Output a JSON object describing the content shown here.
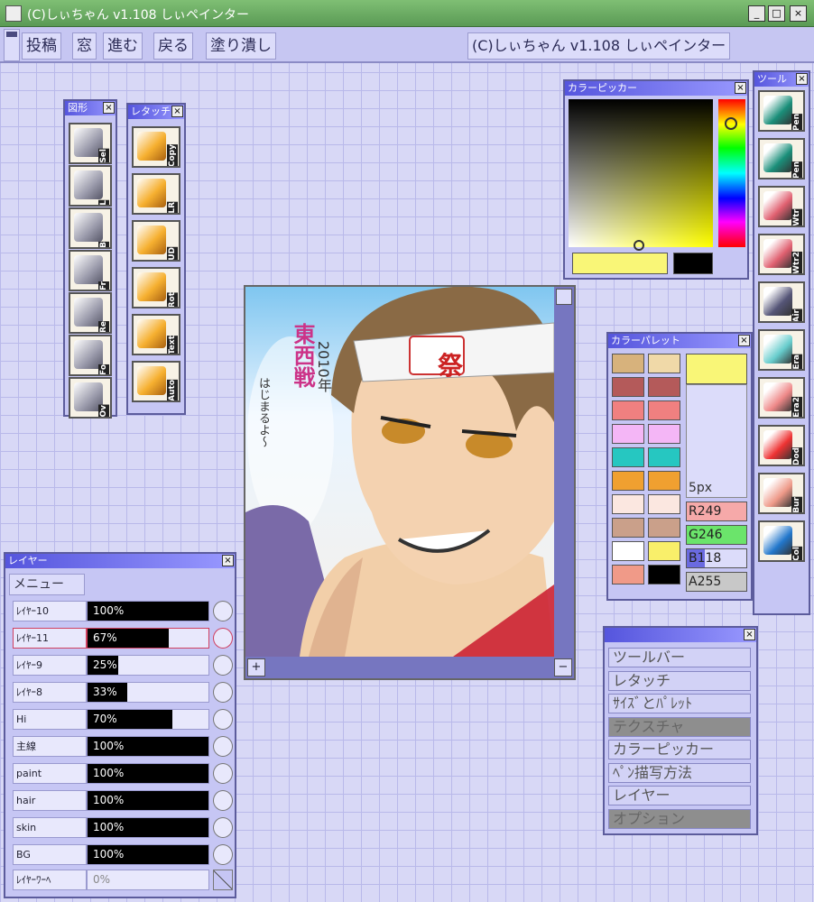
{
  "window": {
    "title": "(C)しぃちゃん v1.108 しぃペインター",
    "min": "_",
    "max": "□",
    "close": "×"
  },
  "menubar": {
    "items": [
      "投稿",
      "窓",
      "進む",
      "戻る",
      "塗り潰し"
    ],
    "about": "(C)しぃちゃん v1.108 しぃペインター"
  },
  "figure_panel": {
    "title": "図形",
    "close": "×",
    "tools": [
      {
        "name": "lasso",
        "label": "Sel"
      },
      {
        "name": "line",
        "label": "L"
      },
      {
        "name": "bezier",
        "label": "B"
      },
      {
        "name": "rect-fill",
        "label": "Fr"
      },
      {
        "name": "rect",
        "label": "Re"
      },
      {
        "name": "oval-fill",
        "label": "Fo"
      },
      {
        "name": "oval",
        "label": "Ov"
      }
    ]
  },
  "retouch_panel": {
    "title": "レタッチ",
    "close": "×",
    "tools": [
      {
        "name": "copy",
        "label": "Copy"
      },
      {
        "name": "flip-h",
        "label": "LR"
      },
      {
        "name": "flip-v",
        "label": "UD"
      },
      {
        "name": "rotate",
        "label": "Rot"
      },
      {
        "name": "text",
        "label": "Text"
      },
      {
        "name": "auto",
        "label": "Auto"
      }
    ]
  },
  "color_picker": {
    "title": "カラーピッカー",
    "close": "×",
    "current_color": "#f9f677",
    "sub_color": "#000000"
  },
  "tool_panel": {
    "title": "ツール",
    "close": "×",
    "tools": [
      {
        "name": "pen",
        "label": "Pen",
        "color": "#1a8f7a"
      },
      {
        "name": "pen2",
        "label": "Pen",
        "color": "#1a8f7a"
      },
      {
        "name": "watercolor",
        "label": "Wtr",
        "color": "#e06070"
      },
      {
        "name": "watercolor2",
        "label": "Wtr2",
        "color": "#e06070"
      },
      {
        "name": "airbrush",
        "label": "Air",
        "color": "#555577"
      },
      {
        "name": "eraser",
        "label": "Era",
        "color": "#6cc"
      },
      {
        "name": "eraser2",
        "label": "Era2",
        "color": "#e88"
      },
      {
        "name": "dodge",
        "label": "Dod",
        "color": "#e33"
      },
      {
        "name": "burn",
        "label": "Bur",
        "color": "#e98"
      },
      {
        "name": "drop",
        "label": "Col",
        "color": "#27c"
      }
    ]
  },
  "palette": {
    "title": "カラーパレット",
    "close": "×",
    "size_label": "5px",
    "swatches_left": [
      "#d7b27c",
      "#b45a5a",
      "#f08080",
      "#f4b6f6",
      "#26c7c1",
      "#f0a030",
      "#fbe7e0",
      "#caa08a",
      "#ffffff",
      "#f09a88"
    ],
    "swatches_right": [
      "#f0d9a8",
      "#b45a5a",
      "#f08080",
      "#f4b6f6",
      "#26c7c1",
      "#f0a030",
      "#fbe7e0",
      "#caa08a",
      "#f9ef6a",
      "#000000"
    ],
    "preview_color": "#f9f677",
    "r": "R249",
    "g": "G246",
    "b": "B118",
    "a": "A255"
  },
  "canvas": {
    "title_text": [
      "東西戦",
      "2010年",
      "はじまるよ〜"
    ],
    "badge": "祭"
  },
  "layer_panel": {
    "title": "レイヤー",
    "close": "×",
    "menu_label": "メニュー",
    "layers": [
      {
        "name": "ﾚｲﾔｰ10",
        "opacity": "100%",
        "level": 1.0
      },
      {
        "name": "ﾚｲﾔｰ11",
        "opacity": "67%",
        "level": 0.67
      },
      {
        "name": "ﾚｲﾔｰ9",
        "opacity": "25%",
        "level": 0.25
      },
      {
        "name": "ﾚｲﾔｰ8",
        "opacity": "33%",
        "level": 0.33
      },
      {
        "name": "Hi",
        "opacity": "70%",
        "level": 0.7
      },
      {
        "name": "主線",
        "opacity": "100%",
        "level": 1.0
      },
      {
        "name": "paint",
        "opacity": "100%",
        "level": 1.0
      },
      {
        "name": "hair",
        "opacity": "100%",
        "level": 1.0
      },
      {
        "name": "skin",
        "opacity": "100%",
        "level": 1.0
      },
      {
        "name": "BG",
        "opacity": "100%",
        "level": 1.0
      }
    ],
    "footer_name": "ﾚｲﾔｰﾜｰﾍ",
    "footer_pct": "0%",
    "selected_index": 1
  },
  "window_menu": {
    "close": "×",
    "items": [
      {
        "label": "ツールバー",
        "dim": false
      },
      {
        "label": "レタッチ",
        "dim": false
      },
      {
        "label": "ｻｲｽﾞとﾊﾟﾚｯﾄ",
        "dim": false
      },
      {
        "label": "テクスチャ",
        "dim": true
      },
      {
        "label": "カラーピッカー",
        "dim": false
      },
      {
        "label": "ﾍﾟﾝ描写方法",
        "dim": false
      },
      {
        "label": "レイヤー",
        "dim": false
      },
      {
        "label": "オプション",
        "dim": true
      }
    ]
  }
}
